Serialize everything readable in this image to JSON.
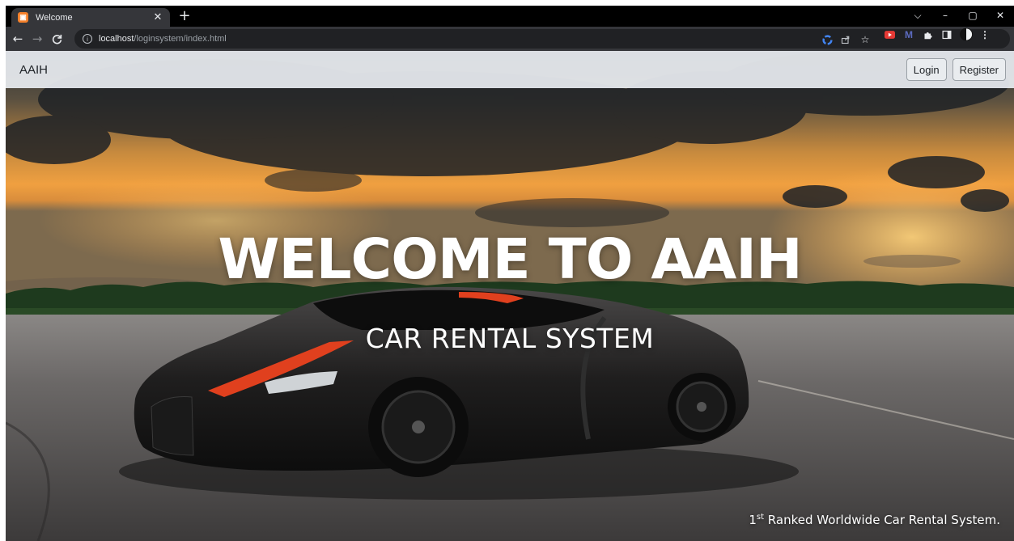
{
  "browser": {
    "tab": {
      "title": "Welcome",
      "favicon_glyph": "▣"
    },
    "newtab_glyph": "+",
    "window_controls": [
      "⌵",
      "–",
      "▢",
      "✕"
    ],
    "url_host": "localhost",
    "url_path": "/loginsystem/index.html",
    "extensions": [
      "google-icon",
      "share-icon",
      "bookmark-star-icon",
      "youtube-ext-icon",
      "m-ext-icon",
      "puzzle-extensions-icon",
      "side-panel-icon",
      "profile-avatar-icon",
      "kebab-menu-icon"
    ]
  },
  "site": {
    "brand": "AAIH",
    "login_label": "Login",
    "register_label": "Register",
    "headline": "WELCOME TO AAIH",
    "subheadline": "CAR RENTAL SYSTEM",
    "tagline_rank": "1",
    "tagline_ordinal": "st",
    "tagline_text": " Ranked Worldwide Car Rental System."
  },
  "colors": {
    "brand_text": "#212529",
    "browser_bg": "#35363a",
    "sky_orange": "#e8963a",
    "car_accent_red": "#e0401e"
  }
}
